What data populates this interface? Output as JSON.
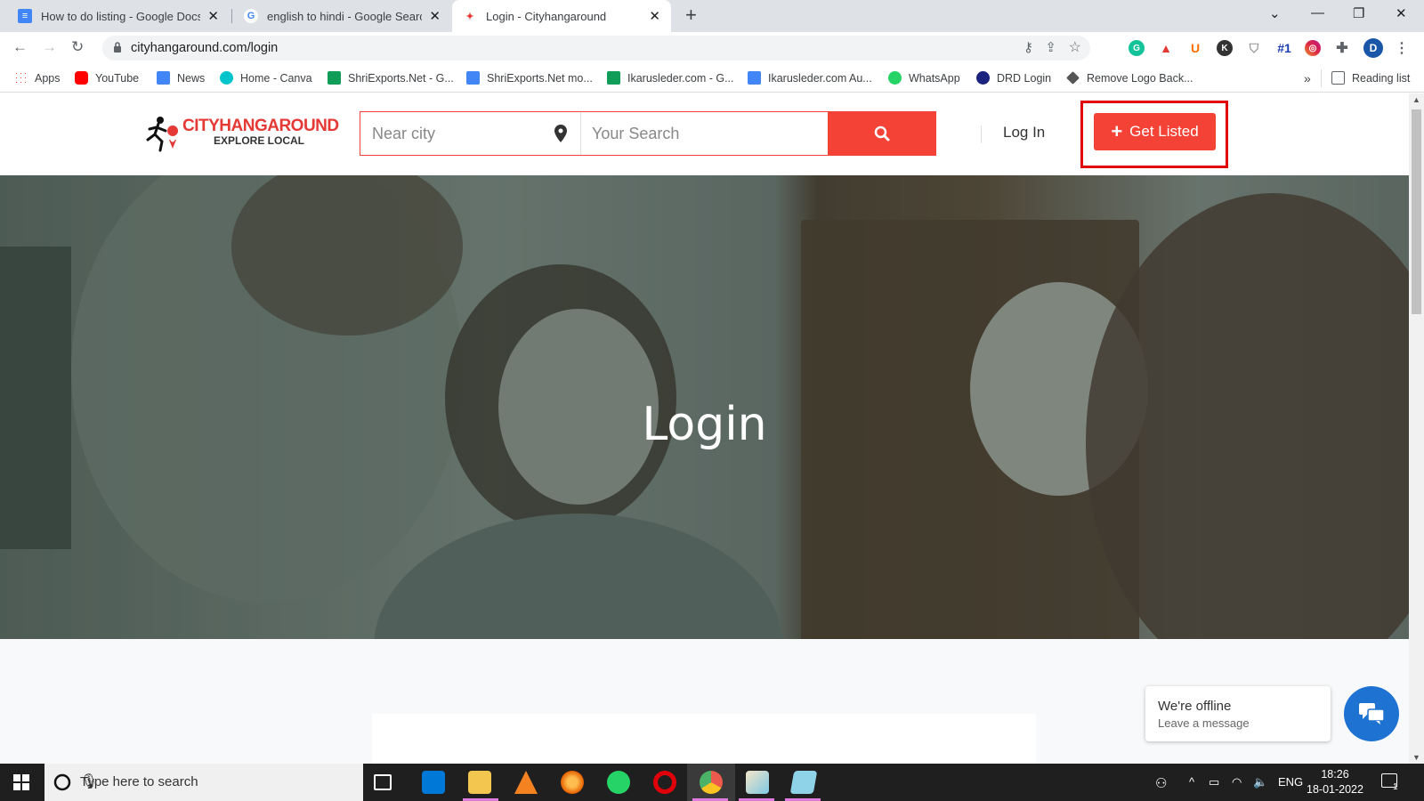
{
  "browser": {
    "tabs": [
      {
        "title": "How to do listing - Google Docs",
        "active": false
      },
      {
        "title": "english to hindi - Google Search",
        "active": false
      },
      {
        "title": "Login - Cityhangaround",
        "active": true
      }
    ],
    "url": "cityhangaround.com/login",
    "bookmarks": [
      {
        "label": "Apps",
        "icon": "apps-grid-icon"
      },
      {
        "label": "YouTube",
        "icon": "youtube-icon"
      },
      {
        "label": "News",
        "icon": "news-icon"
      },
      {
        "label": "Home - Canva",
        "icon": "canva-icon"
      },
      {
        "label": "ShriExports.Net - G...",
        "icon": "sheets-icon"
      },
      {
        "label": "ShriExports.Net mo...",
        "icon": "docs-icon"
      },
      {
        "label": "Ikarusleder.com - G...",
        "icon": "sheets-icon"
      },
      {
        "label": "Ikarusleder.com Au...",
        "icon": "docs-icon"
      },
      {
        "label": "WhatsApp",
        "icon": "whatsapp-icon"
      },
      {
        "label": "DRD Login",
        "icon": "database-icon"
      },
      {
        "label": "Remove Logo Back...",
        "icon": "layers-icon"
      }
    ],
    "reading_list": "Reading list",
    "more_bookmarks": "»",
    "profile_initial": "D",
    "extension_badge": "#1"
  },
  "site": {
    "logo": {
      "brand_a": "CITYHANG",
      "brand_b": "AROUND",
      "tagline": "EXPLORE LOCAL"
    },
    "search": {
      "near_placeholder": "Near city",
      "query_placeholder": "Your Search"
    },
    "login_link": "Log In",
    "get_listed": "Get Listed",
    "hero_title": "Login",
    "accent_color": "#f44336"
  },
  "chat": {
    "status": "We're offline",
    "prompt": "Leave a message"
  },
  "taskbar": {
    "search_placeholder": "Type here to search",
    "language": "ENG",
    "time": "18:26",
    "date": "18-01-2022",
    "notification_count": "1"
  }
}
